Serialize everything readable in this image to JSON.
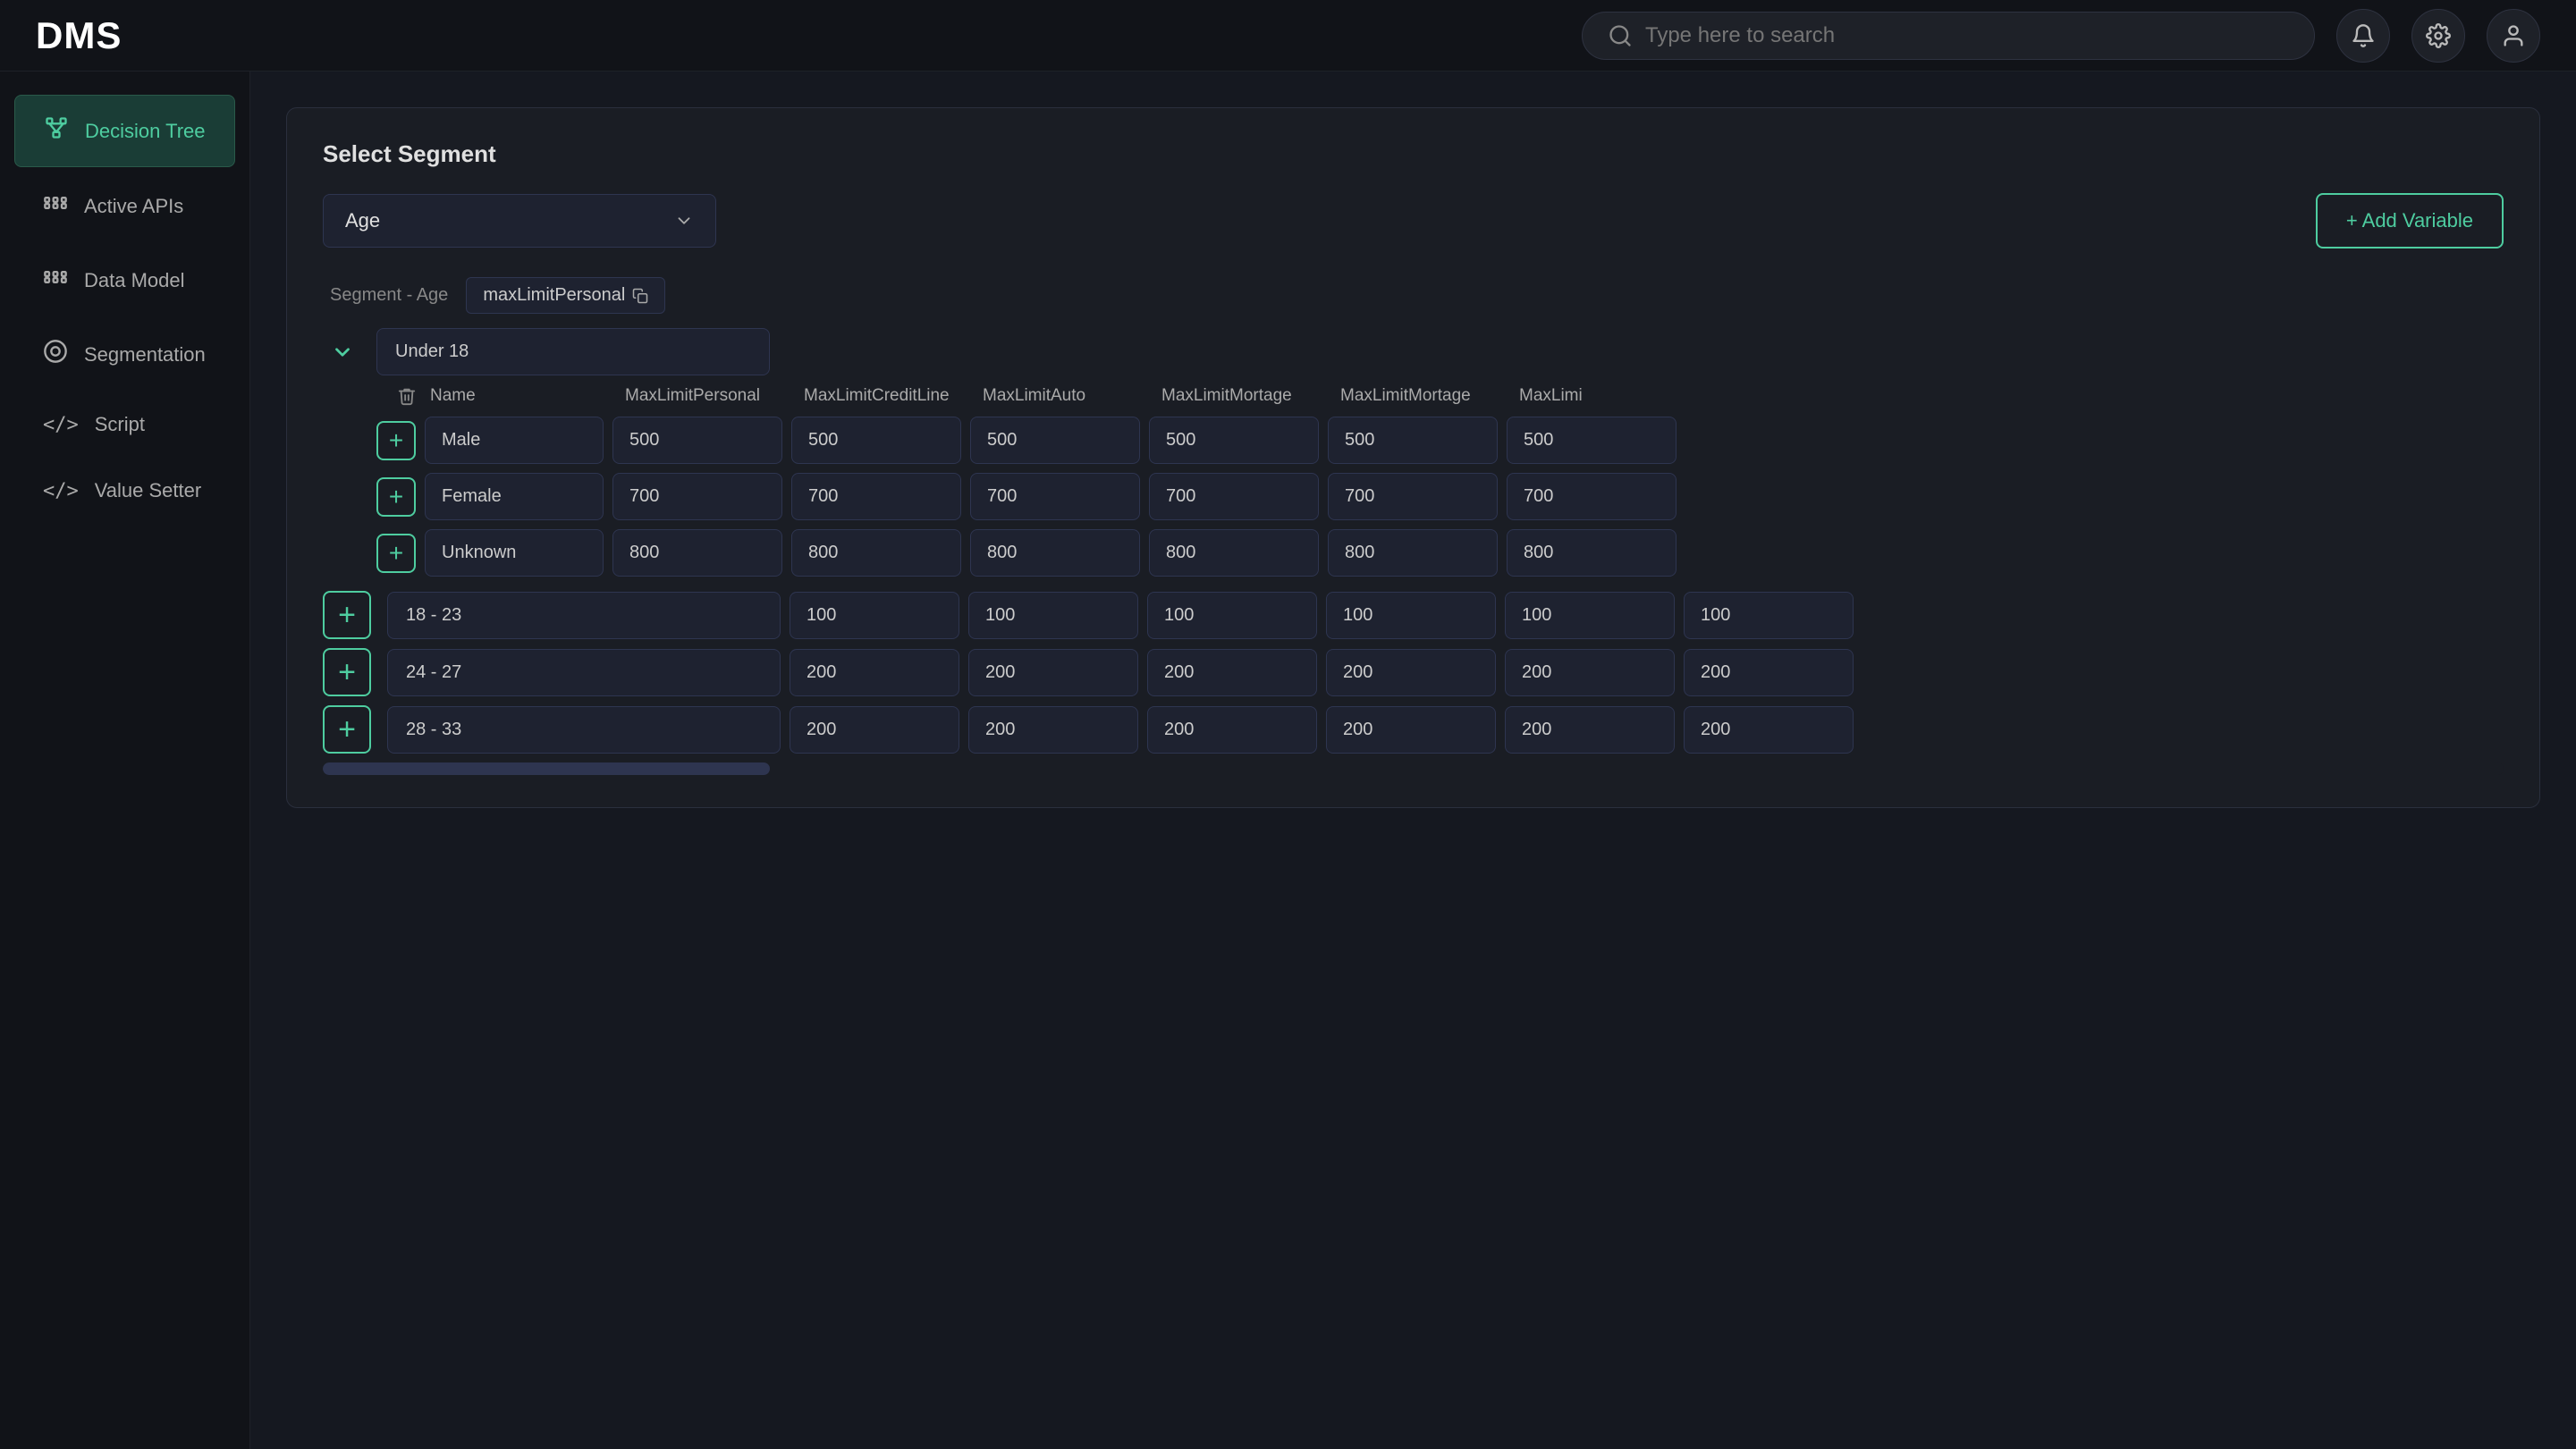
{
  "app": {
    "logo": "DMS"
  },
  "topbar": {
    "search_placeholder": "Type here to search",
    "bell_icon": "bell",
    "gear_icon": "gear",
    "user_icon": "user"
  },
  "sidebar": {
    "items": [
      {
        "id": "decision-tree",
        "label": "Decision Tree",
        "icon": "🌿",
        "active": true
      },
      {
        "id": "active-apis",
        "label": "Active APIs",
        "icon": "⚙️",
        "active": false
      },
      {
        "id": "data-model",
        "label": "Data Model",
        "icon": "⚙️",
        "active": false
      },
      {
        "id": "segmentation",
        "label": "Segmentation",
        "icon": "◎",
        "active": false
      },
      {
        "id": "script",
        "label": "Script",
        "icon": "</>",
        "active": false
      },
      {
        "id": "value-setter",
        "label": "Value Setter",
        "icon": "</>",
        "active": false
      }
    ]
  },
  "panel": {
    "title": "Select Segment",
    "dropdown_value": "Age",
    "dropdown_placeholder": "Age",
    "add_variable_label": "+ Add Variable",
    "segment_label": "Segment  - Age",
    "tag_label": "maxLimitPersonal",
    "columns": [
      "Name",
      "MaxLimitPersonal",
      "MaxLimitCreditLine",
      "MaxLimitAuto",
      "MaxLimitMortage",
      "MaxLimitMortage",
      "MaxLimi"
    ],
    "under18": {
      "label": "Under 18",
      "rows": [
        {
          "name": "Male",
          "values": [
            "500",
            "500",
            "500",
            "500",
            "500",
            "500"
          ]
        },
        {
          "name": "Female",
          "values": [
            "700",
            "700",
            "700",
            "700",
            "700",
            "700"
          ]
        },
        {
          "name": "Unknown",
          "values": [
            "800",
            "800",
            "800",
            "800",
            "800",
            "800"
          ]
        }
      ]
    },
    "outer_rows": [
      {
        "label": "18 - 23",
        "values": [
          "100",
          "100",
          "100",
          "100",
          "100",
          "100"
        ]
      },
      {
        "label": "24 - 27",
        "values": [
          "200",
          "200",
          "200",
          "200",
          "200",
          "200"
        ]
      },
      {
        "label": "28 - 33",
        "values": [
          "200",
          "200",
          "200",
          "200",
          "200",
          "200"
        ]
      }
    ]
  }
}
